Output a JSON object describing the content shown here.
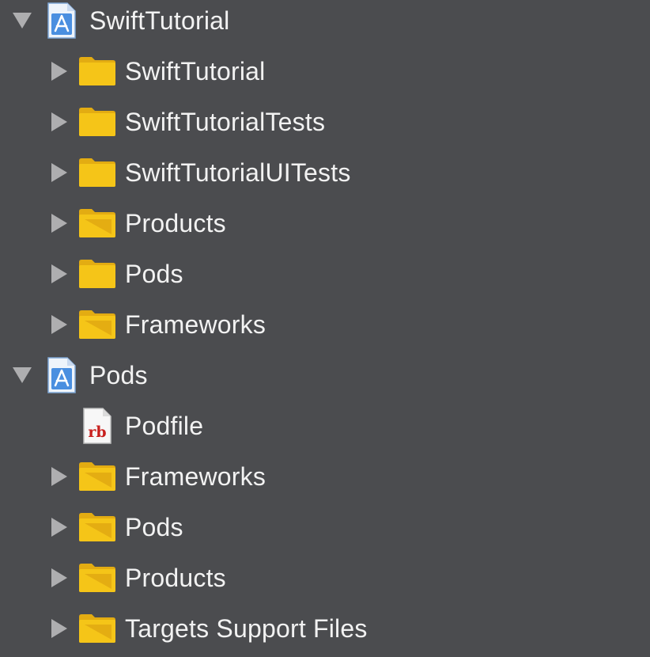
{
  "navigator": {
    "items": [
      {
        "label": "SwiftTutorial",
        "kind": "project",
        "expanded": true,
        "level": 0,
        "icon": "xcode-project-icon"
      },
      {
        "label": "SwiftTutorial",
        "kind": "folder",
        "expanded": false,
        "level": 1,
        "icon": "folder-icon"
      },
      {
        "label": "SwiftTutorialTests",
        "kind": "folder",
        "expanded": false,
        "level": 1,
        "icon": "folder-icon"
      },
      {
        "label": "SwiftTutorialUITests",
        "kind": "folder",
        "expanded": false,
        "level": 1,
        "icon": "folder-icon"
      },
      {
        "label": "Products",
        "kind": "group",
        "expanded": false,
        "level": 1,
        "icon": "group-folder-icon"
      },
      {
        "label": "Pods",
        "kind": "folder",
        "expanded": false,
        "level": 1,
        "icon": "folder-icon"
      },
      {
        "label": "Frameworks",
        "kind": "group",
        "expanded": false,
        "level": 1,
        "icon": "group-folder-icon"
      },
      {
        "label": "Pods",
        "kind": "project",
        "expanded": true,
        "level": 0,
        "icon": "xcode-project-icon"
      },
      {
        "label": "Podfile",
        "kind": "file",
        "expanded": null,
        "level": 1,
        "icon": "ruby-file-icon",
        "badge": "rb"
      },
      {
        "label": "Frameworks",
        "kind": "group",
        "expanded": false,
        "level": 1,
        "icon": "group-folder-icon"
      },
      {
        "label": "Pods",
        "kind": "group",
        "expanded": false,
        "level": 1,
        "icon": "group-folder-icon"
      },
      {
        "label": "Products",
        "kind": "group",
        "expanded": false,
        "level": 1,
        "icon": "group-folder-icon"
      },
      {
        "label": "Targets Support Files",
        "kind": "group",
        "expanded": false,
        "level": 1,
        "icon": "group-folder-icon"
      }
    ]
  },
  "colors": {
    "background": "#4b4c4f",
    "text": "#f2f2f2",
    "disclosure": "#aeaeb0",
    "folder": "#f5c518",
    "folder_tab": "#e3ac12",
    "project_blue": "#4a8fe0",
    "ruby_red": "#c8201e"
  }
}
